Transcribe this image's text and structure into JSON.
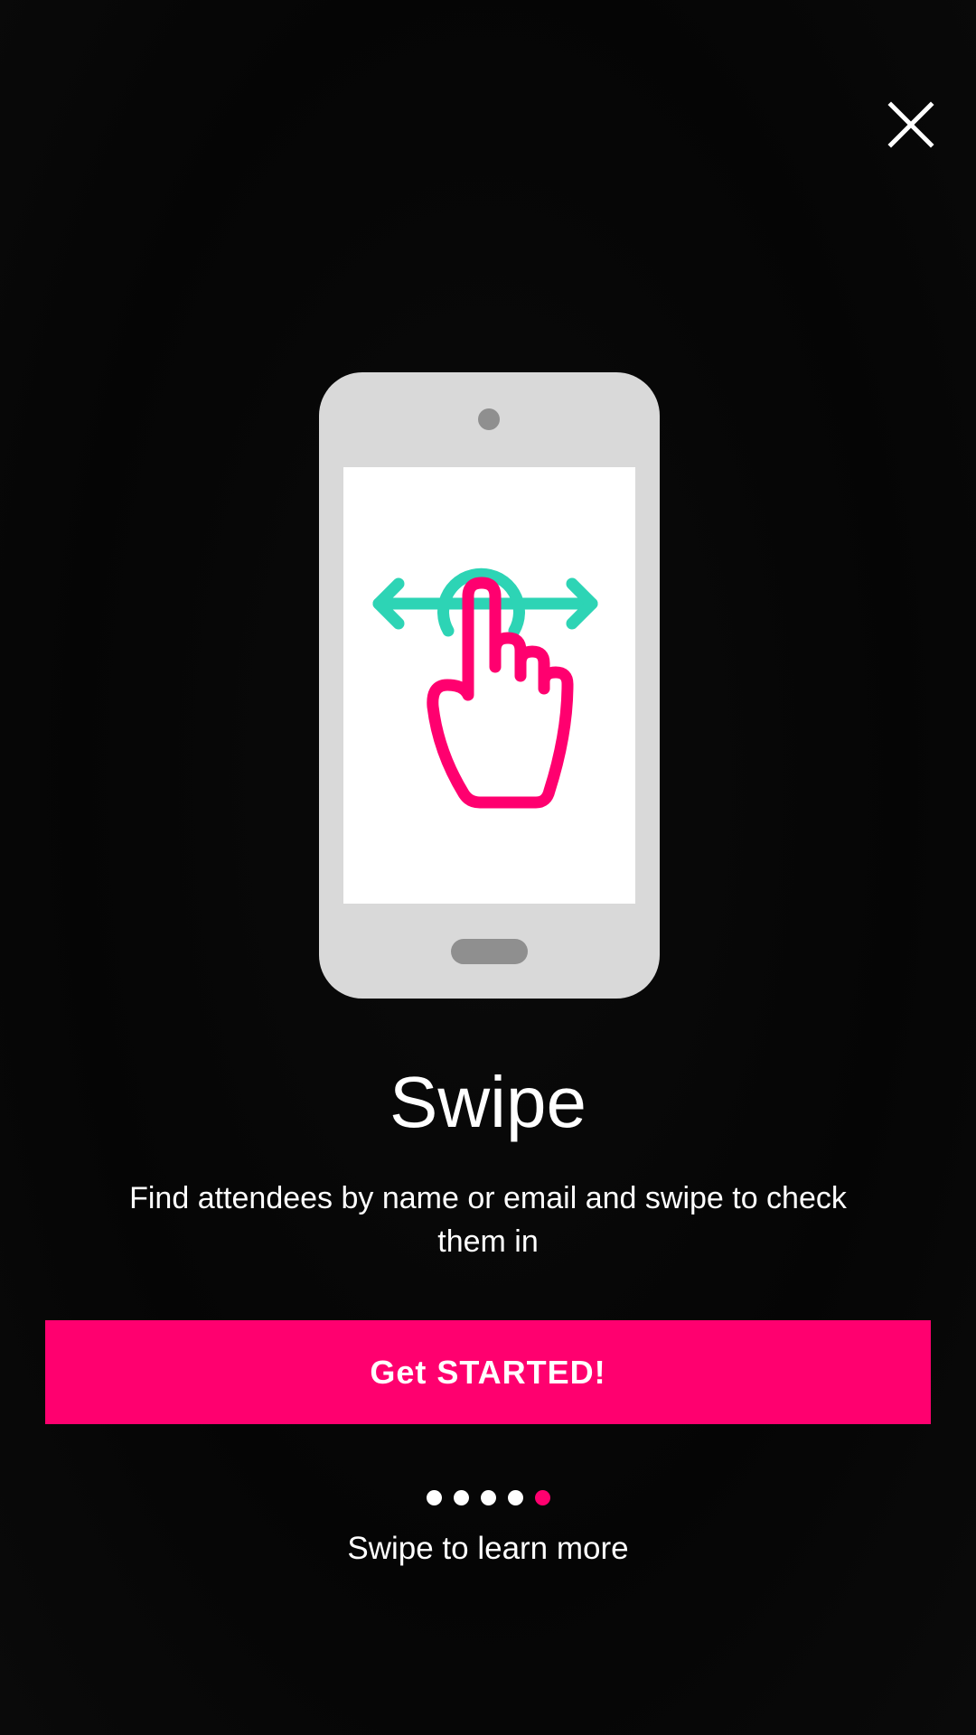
{
  "onboarding": {
    "title": "Swipe",
    "description": "Find attendees by name or email and swipe to check them in",
    "cta_label": "Get STARTED!",
    "hint": "Swipe to learn more",
    "page_indicator": {
      "total": 5,
      "current": 5
    }
  },
  "icons": {
    "close": "close-icon",
    "illustration": "phone-swipe-illustration"
  },
  "colors": {
    "accent": "#ff006f",
    "gesture_arrows": "#2dd4b5",
    "phone_body": "#d9d9d9",
    "phone_details": "#8f8f8f",
    "background": "#070707"
  }
}
